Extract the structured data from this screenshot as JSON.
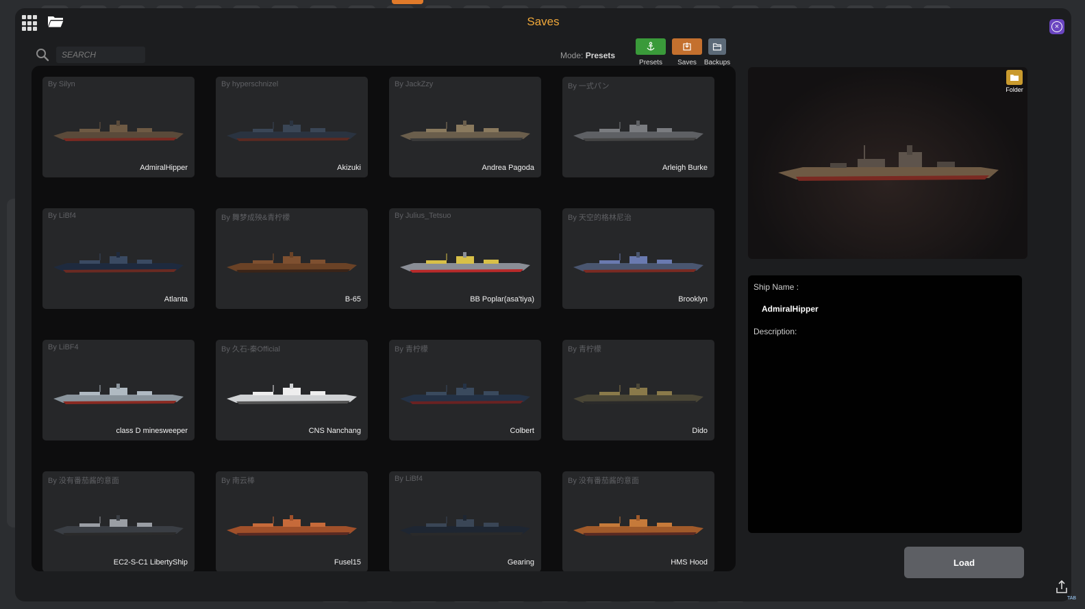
{
  "window": {
    "title": "Saves"
  },
  "search": {
    "placeholder": "SEARCH"
  },
  "mode": {
    "label": "Mode:",
    "value": "Presets"
  },
  "mode_buttons": [
    {
      "label": "Presets",
      "color": "#3a9a3a",
      "icon": "anchor-icon"
    },
    {
      "label": "Saves",
      "color": "#c4702e",
      "icon": "save-icon"
    },
    {
      "label": "Backups",
      "color": "#5c6a78",
      "icon": "folder-icon"
    }
  ],
  "ships": [
    {
      "author": "By  Silyn",
      "name": "AdmiralHipper",
      "hull": "#5a4a3a",
      "deck": "#6e5a44",
      "stripe": "#7a2a22"
    },
    {
      "author": "By  hyperschnizel",
      "name": "Akizuki",
      "hull": "#2a3340",
      "deck": "#3a4656",
      "stripe": "#5a2a22"
    },
    {
      "author": "By  JackZzy",
      "name": "Andrea Pagoda",
      "hull": "#6a5e4c",
      "deck": "#8a7a5e",
      "stripe": "#3a3a3a"
    },
    {
      "author": "By  一式パン",
      "name": "Arleigh Burke",
      "hull": "#5e6064",
      "deck": "#7a7c80",
      "stripe": "#444"
    },
    {
      "author": "By  LiBf4",
      "name": "Atlanta",
      "hull": "#1e2a3e",
      "deck": "#3a4a62",
      "stripe": "#6a2a22"
    },
    {
      "author": "By  舞梦成殃&青柠檬",
      "name": "B-65",
      "hull": "#6a4226",
      "deck": "#7e5030",
      "stripe": "#3a2418"
    },
    {
      "author": "By  Julius_Tetsuo",
      "name": "BB Poplar(asa'tiya)",
      "hull": "#8a8e96",
      "deck": "#d8c048",
      "stripe": "#b82a2a"
    },
    {
      "author": "By  天空的格林尼治",
      "name": "Brooklyn",
      "hull": "#4a5670",
      "deck": "#6a7ab0",
      "stripe": "#7a2a22"
    },
    {
      "author": "By  LiBF4",
      "name": "class D minesweeper",
      "hull": "#8a949c",
      "deck": "#b0bac2",
      "stripe": "#8a2a22"
    },
    {
      "author": "By  久石-秦Official",
      "name": "CNS Nanchang",
      "hull": "#d0d2d4",
      "deck": "#eeeeee",
      "stripe": "#555"
    },
    {
      "author": "By  青柠檬",
      "name": "Colbert",
      "hull": "#243246",
      "deck": "#3a4a5e",
      "stripe": "#6a2222"
    },
    {
      "author": "By  青柠檬",
      "name": "Dido",
      "hull": "#4a4636",
      "deck": "#8a7a4a",
      "stripe": "#2a2a2a"
    },
    {
      "author": "By  没有番茄酱的意面",
      "name": "EC2-S-C1 LibertyShip",
      "hull": "#3a3e44",
      "deck": "#9a9ea4",
      "stripe": "#2a2a2a"
    },
    {
      "author": "By  南云棒",
      "name": "Fusel15",
      "hull": "#a0502a",
      "deck": "#c66a3a",
      "stripe": "#5a2a22"
    },
    {
      "author": "By  LiBf4",
      "name": "Gearing",
      "hull": "#1e2632",
      "deck": "#3a4656",
      "stripe": "#2a2a2a"
    },
    {
      "author": "By  没有番茄酱的意面",
      "name": "HMS Hood",
      "hull": "#a05a2a",
      "deck": "#c67a3a",
      "stripe": "#5a2a22"
    }
  ],
  "preview": {
    "folder_label": "Folder"
  },
  "details": {
    "ship_name_label": "Ship Name :",
    "ship_name_value": "AdmiralHipper",
    "description_label": "Description:"
  },
  "actions": {
    "load_label": "Load"
  },
  "hints": {
    "tab": "TAB"
  }
}
